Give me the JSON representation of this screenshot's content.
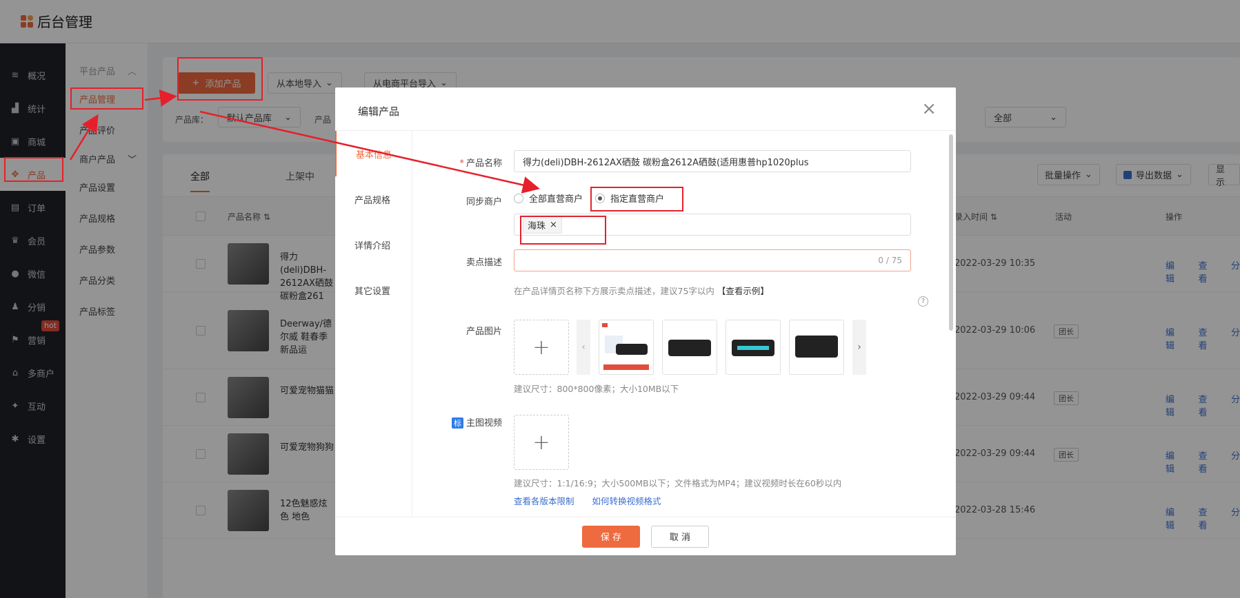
{
  "app": {
    "title": "后台管理"
  },
  "nav": [
    {
      "icon": "layers-icon",
      "glyph": "≋",
      "label": "概况"
    },
    {
      "icon": "chart-icon",
      "glyph": "▟",
      "label": "统计"
    },
    {
      "icon": "store-icon",
      "glyph": "▣",
      "label": "商城"
    },
    {
      "icon": "product-icon",
      "glyph": "✥",
      "label": "产品"
    },
    {
      "icon": "order-icon",
      "glyph": "▤",
      "label": "订单"
    },
    {
      "icon": "crown-icon",
      "glyph": "♛",
      "label": "会员"
    },
    {
      "icon": "wechat-icon",
      "glyph": "●",
      "label": "微信"
    },
    {
      "icon": "user-share-icon",
      "glyph": "♟",
      "label": "分销"
    },
    {
      "icon": "flag-icon",
      "glyph": "⚑",
      "label": "营销",
      "badge": "hot"
    },
    {
      "icon": "multi-store-icon",
      "glyph": "⌂",
      "label": "多商户"
    },
    {
      "icon": "interact-icon",
      "glyph": "✦",
      "label": "互动"
    },
    {
      "icon": "gear-icon",
      "glyph": "✱",
      "label": "设置"
    }
  ],
  "submenu": {
    "group1": "平台产品",
    "items1": [
      "产品管理",
      "产品评价"
    ],
    "group2": "商户产品",
    "items2": [
      "产品设置",
      "产品规格",
      "产品参数",
      "产品分类",
      "产品标签"
    ]
  },
  "toolbar": {
    "add": "添加产品",
    "import_local": "从本地导入",
    "import_ecom": "从电商平台导入",
    "lib_label": "产品库：",
    "lib_value": "默认产品库",
    "second_label": "产品",
    "right_select": "全部"
  },
  "list": {
    "tabs": [
      "全部",
      "上架中"
    ],
    "batch": "批量操作",
    "export": "导出数据",
    "show": "显示",
    "col_name": "产品名称",
    "col_time": "录入时间",
    "col_activity": "活动",
    "col_ops": "操作",
    "ops": [
      "编辑",
      "查看",
      "分"
    ],
    "rows": [
      {
        "name": "得力(deli)DBH-2612AX硒鼓 碳粉盒261",
        "time": "2022-03-29 10:35",
        "tag": ""
      },
      {
        "name": "Deerway/德尔威 鞋春季新品运",
        "time": "2022-03-29 10:06",
        "tag": "团长"
      },
      {
        "name": "可爱宠物猫猫",
        "time": "2022-03-29 09:44",
        "tag": "团长"
      },
      {
        "name": "可爱宠物狗狗",
        "time": "2022-03-29 09:44",
        "tag": "团长"
      },
      {
        "name": "12色魅惑炫色 地色",
        "time": "2022-03-28 15:46",
        "tag": ""
      }
    ]
  },
  "modal": {
    "title": "编辑产品",
    "tabs": [
      "基本信息",
      "产品规格",
      "详情介绍",
      "其它设置"
    ],
    "fields": {
      "name_label": "产品名称",
      "name_value": "得力(deli)DBH-2612AX硒鼓 碳粉盒2612A硒鼓(适用惠普hp1020plus",
      "sync_label": "同步商户",
      "radio_all": "全部直营商户",
      "radio_specific": "指定直营商户",
      "merchant_tag": "海珠",
      "selling_label": "卖点描述",
      "selling_value": "",
      "selling_counter": "0 / 75",
      "selling_hint": "在产品详情页名称下方展示卖点描述，建议75字以内",
      "selling_example": "【查看示例】",
      "image_label": "产品图片",
      "image_hint": "建议尺寸：800*800像素；大小10MB以下",
      "video_badge": "标",
      "video_label": "主图视频",
      "video_hint": "建议尺寸：1:1/16:9；大小500MB以下；文件格式为MP4；建议视频时长在60秒以内",
      "video_link1": "查看各版本限制",
      "video_link2": "如何转换视频格式"
    },
    "save": "保 存",
    "cancel": "取 消"
  },
  "colors": {
    "accent": "#ee6a3f",
    "annotation": "#e5202a",
    "link": "#3a6fcf"
  }
}
